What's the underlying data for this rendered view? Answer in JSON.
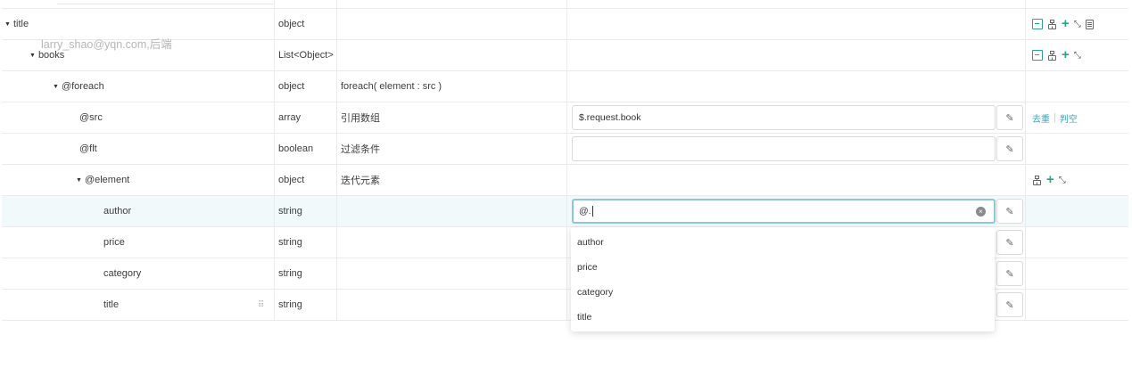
{
  "watermark": "larry_shao@yqn.com,后端",
  "rows": [
    {
      "name": "title",
      "type": "object",
      "desc": "",
      "value": null,
      "ops": [
        "exit-icon",
        "org-icon",
        "plus-icon",
        "collapse-icon",
        "doc-icon"
      ]
    },
    {
      "name": "books",
      "type": "List<Object>",
      "desc": "",
      "value": null,
      "ops": [
        "exit-icon",
        "org-icon",
        "plus-icon",
        "collapse-icon"
      ]
    },
    {
      "name": "@foreach",
      "type": "object",
      "desc": "foreach( element : src )",
      "value": null,
      "ops": []
    },
    {
      "name": "@src",
      "type": "array",
      "desc": "引用数组",
      "value": "$.request.book",
      "links": [
        "去重",
        "判空"
      ]
    },
    {
      "name": "@flt",
      "type": "boolean",
      "desc": "过滤条件",
      "value": ""
    },
    {
      "name": "@element",
      "type": "object",
      "desc": "迭代元素",
      "value": null,
      "ops": [
        "org-icon",
        "plus-icon",
        "collapse-icon"
      ]
    },
    {
      "name": "author",
      "type": "string",
      "desc": "",
      "value": "@."
    },
    {
      "name": "price",
      "type": "string",
      "desc": "",
      "value": ""
    },
    {
      "name": "category",
      "type": "string",
      "desc": "",
      "value": ""
    },
    {
      "name": "title",
      "type": "string",
      "desc": "",
      "value": ""
    }
  ],
  "dropdown": {
    "options": [
      "author",
      "price",
      "category",
      "title"
    ]
  },
  "colors": {
    "accent": "#2aa48c",
    "link": "#3aa7b8",
    "focus": "#8dc9d3"
  }
}
